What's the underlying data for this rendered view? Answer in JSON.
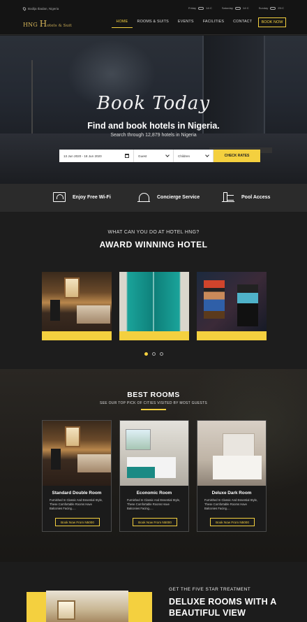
{
  "topbar": {
    "location": "Bodija Ibadan, Nigeria",
    "weather": [
      {
        "day": "Friday",
        "temp": "14◦C"
      },
      {
        "day": "Saturday",
        "temp": "14◦C"
      },
      {
        "day": "Sunday",
        "temp": "25◦C"
      }
    ]
  },
  "header": {
    "logo_prefix": "HNG ",
    "logo_big": "H",
    "logo_suffix": "otels & Suit",
    "nav": [
      "HOME",
      "ROOMS  & SUITS",
      "EVENTS",
      "FACILITIES",
      "CONTACT"
    ],
    "book_now": "BOOK NOW"
  },
  "hero": {
    "script": "Book Today",
    "title": "Find and book hotels in Nigeria.",
    "subtitle": "Search through 12,879 hotels in Nigeria"
  },
  "search": {
    "dates": "13 Jun 2020 - 18 Jun 2020",
    "guest": "Guest",
    "children": "Children",
    "button": "CHECK RATES"
  },
  "amenities": [
    {
      "label": "Enjoy Free Wi-Fi",
      "icon": "wifi-icon"
    },
    {
      "label": "Concierge Service",
      "icon": "concierge-bell-icon"
    },
    {
      "label": "Pool Access",
      "icon": "pool-icon"
    }
  ],
  "award": {
    "kicker": "WHAT CAN YOU DO AT HOTEL HNG?",
    "title": "AWARD WINNING HOTEL"
  },
  "best_rooms": {
    "title": "BEST ROOMS",
    "subtitle": "SEE OUR TOP PICK OF CITIES VISITED BY MOST GUESTS",
    "rooms": [
      {
        "name": "Standard Double Room",
        "desc": "Furnished In Classic And Essential Style, These Comfortable Rooms Have Balconies Facing.....",
        "button": "Book Now From N5000"
      },
      {
        "name": "Economic Room",
        "desc": "Furnished In Classic And Essential Style, These Comfortable Rooms Have Balconies Facing.....",
        "button": "Book Now From N5000"
      },
      {
        "name": "Deluxe Dark Room",
        "desc": "Furnished In Classic And Essential Style, These Comfortable Rooms Have Balconies Facing.....",
        "button": "Book Now From N5000"
      }
    ]
  },
  "feature": {
    "kicker": "GET THE FIVE STAR TREATMENT",
    "title": "DELUXE ROOMS WITH A BEAUTIFUL VIEW"
  },
  "colors": {
    "accent": "#f4d03f",
    "background": "#1c1c1c"
  }
}
